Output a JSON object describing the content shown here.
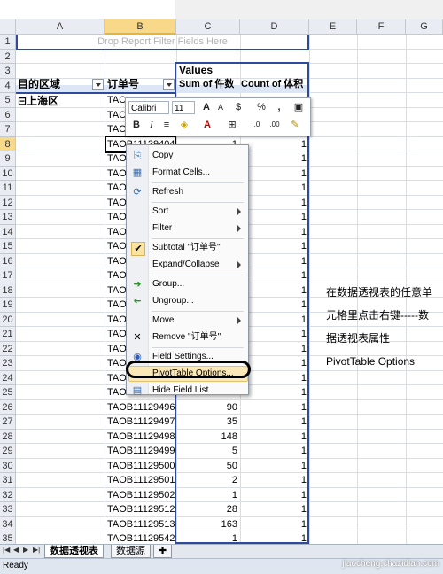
{
  "columns": [
    "A",
    "B",
    "C",
    "D",
    "E",
    "F",
    "G"
  ],
  "rows": [
    1,
    2,
    3,
    4,
    5,
    6,
    7,
    8,
    9,
    10,
    11,
    12,
    13,
    14,
    15,
    16,
    17,
    18,
    19,
    20,
    21,
    22,
    23,
    24,
    25,
    26,
    27,
    28,
    29,
    30,
    31,
    32,
    33,
    34,
    35
  ],
  "active_row": 8,
  "active_column": "B",
  "filter_placeholder": "Drop Report Filter Fields Here",
  "values_header": "Values",
  "col_a_header": "目的区域",
  "col_b_header": "订单号",
  "col_c_header": "Sum of 件数",
  "col_d_header": "Count of 体积",
  "region": "⊟上海区",
  "order_rows": [
    {
      "row": 5,
      "order": "TAO",
      "c": "",
      "d": ""
    },
    {
      "row": 6,
      "order": "TAO",
      "c": "",
      "d": ""
    },
    {
      "row": 7,
      "order": "TAO",
      "c": "",
      "d": ""
    },
    {
      "row": 8,
      "order": "TAOB11129404",
      "c": "1",
      "d": "1"
    },
    {
      "row": 9,
      "order": "TAO",
      "c": "",
      "d": "1"
    },
    {
      "row": 10,
      "order": "TAO",
      "c": "",
      "d": "1"
    },
    {
      "row": 11,
      "order": "TAO",
      "c": "",
      "d": "1"
    },
    {
      "row": 12,
      "order": "TAO",
      "c": "",
      "d": "1"
    },
    {
      "row": 13,
      "order": "TAO",
      "c": "",
      "d": "1"
    },
    {
      "row": 14,
      "order": "TAO",
      "c": "",
      "d": "1"
    },
    {
      "row": 15,
      "order": "TAO",
      "c": "",
      "d": "1"
    },
    {
      "row": 16,
      "order": "TAO",
      "c": "",
      "d": "1"
    },
    {
      "row": 17,
      "order": "TAO",
      "c": "",
      "d": "1"
    },
    {
      "row": 18,
      "order": "TAO",
      "c": "",
      "d": "1"
    },
    {
      "row": 19,
      "order": "TAO",
      "c": "",
      "d": "1"
    },
    {
      "row": 20,
      "order": "TAO",
      "c": "",
      "d": "1"
    },
    {
      "row": 21,
      "order": "TAO",
      "c": "",
      "d": "1"
    },
    {
      "row": 22,
      "order": "TAO",
      "c": "",
      "d": "1"
    },
    {
      "row": 23,
      "order": "TAO",
      "c": "",
      "d": "1"
    },
    {
      "row": 24,
      "order": "TAO",
      "c": "",
      "d": "1"
    },
    {
      "row": 25,
      "order": "TAOB11129495",
      "c": "",
      "d": "1"
    },
    {
      "row": 26,
      "order": "TAOB11129496",
      "c": "90",
      "d": "1"
    },
    {
      "row": 27,
      "order": "TAOB11129497",
      "c": "35",
      "d": "1"
    },
    {
      "row": 28,
      "order": "TAOB11129498",
      "c": "148",
      "d": "1"
    },
    {
      "row": 29,
      "order": "TAOB11129499",
      "c": "5",
      "d": "1"
    },
    {
      "row": 30,
      "order": "TAOB11129500",
      "c": "50",
      "d": "1"
    },
    {
      "row": 31,
      "order": "TAOB11129501",
      "c": "2",
      "d": "1"
    },
    {
      "row": 32,
      "order": "TAOB11129502",
      "c": "1",
      "d": "1"
    },
    {
      "row": 33,
      "order": "TAOB11129512",
      "c": "28",
      "d": "1"
    },
    {
      "row": 34,
      "order": "TAOB11129513",
      "c": "163",
      "d": "1"
    },
    {
      "row": 35,
      "order": "TAOB11129542",
      "c": "1",
      "d": "1"
    }
  ],
  "mini_toolbar": {
    "font": "Calibri",
    "size": "11",
    "bold": "B",
    "italic": "I",
    "grow": "A",
    "shrink": "A",
    "currency": "$",
    "percent": "%",
    "comma": ","
  },
  "context_menu": [
    {
      "label": "Copy",
      "icon": "copy-icon",
      "glyph": "⎘",
      "submenu": false
    },
    {
      "label": "Format Cells...",
      "icon": "format-cells-icon",
      "glyph": "▦",
      "submenu": false
    },
    {
      "sep": true
    },
    {
      "label": "Refresh",
      "icon": "refresh-icon",
      "glyph": "⟳",
      "submenu": false
    },
    {
      "sep": true
    },
    {
      "label": "Sort",
      "icon": "",
      "glyph": "",
      "submenu": true
    },
    {
      "label": "Filter",
      "icon": "",
      "glyph": "",
      "submenu": true
    },
    {
      "sep": true
    },
    {
      "label": "Subtotal \"订单号\"",
      "icon": "checkmark-icon",
      "glyph": "✔",
      "submenu": false
    },
    {
      "label": "Expand/Collapse",
      "icon": "",
      "glyph": "",
      "submenu": true
    },
    {
      "sep": true
    },
    {
      "label": "Group...",
      "icon": "group-arrow-icon",
      "glyph": "➜",
      "submenu": false
    },
    {
      "label": "Ungroup...",
      "icon": "ungroup-arrow-icon",
      "glyph": "➜",
      "submenu": false
    },
    {
      "sep": true
    },
    {
      "label": "Move",
      "icon": "",
      "glyph": "",
      "submenu": true
    },
    {
      "label": "Remove \"订单号\"",
      "icon": "remove-x-icon",
      "glyph": "✕",
      "submenu": false
    },
    {
      "sep": true
    },
    {
      "label": "Field Settings...",
      "icon": "field-settings-icon",
      "glyph": "◉",
      "submenu": false
    },
    {
      "label": "PivotTable Options...",
      "icon": "",
      "glyph": "",
      "submenu": false,
      "highlight": true
    },
    {
      "label": "Hide Field List",
      "icon": "field-list-icon",
      "glyph": "▤",
      "submenu": false
    }
  ],
  "note_lines": [
    "在数据透视表的任意单",
    "元格里点击右键-----数",
    "据透视表属性",
    "PivotTable Options"
  ],
  "sheet_tabs": [
    "数据透视表",
    "数据源"
  ],
  "status": "Ready",
  "watermark": "jiaocheng.chazidian.com",
  "colors": {
    "pivot_border": "#2d4a9c",
    "highlight": "#fbe8b8",
    "header": "#e9edf3"
  }
}
